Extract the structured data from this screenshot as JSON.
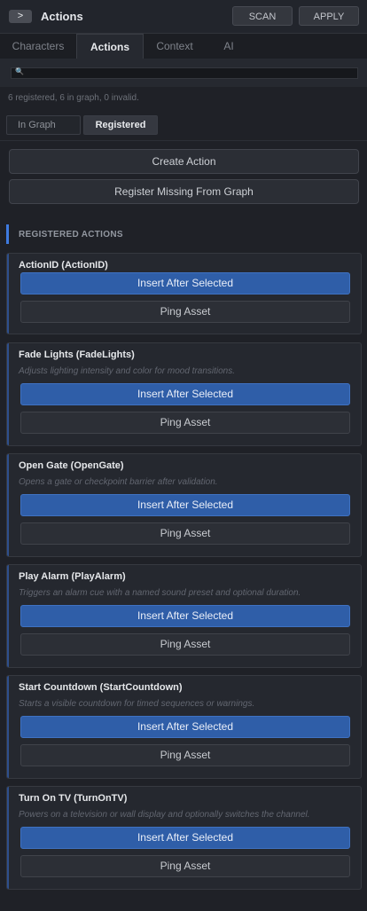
{
  "header": {
    "toggle_icon": "chevron-right-icon",
    "toggle_glyph": ">",
    "title": "Actions",
    "scan_label": "SCAN",
    "apply_label": "APPLY"
  },
  "tabs": [
    {
      "label": "Characters",
      "active": false
    },
    {
      "label": "Actions",
      "active": true
    },
    {
      "label": "Context",
      "active": false
    },
    {
      "label": "AI",
      "active": false
    }
  ],
  "search": {
    "value": "",
    "placeholder": "",
    "icon": "search-icon",
    "glyph": "🔍"
  },
  "status": "6 registered, 6 in graph, 0 invalid.",
  "filter": {
    "in_graph": "In Graph",
    "registered": "Registered",
    "selected": "Registered"
  },
  "buttons": {
    "create": "Create Action",
    "register_missing": "Register Missing From Graph"
  },
  "section_title": "REGISTERED ACTIONS",
  "cards": [
    {
      "title": "ActionID (ActionID)",
      "description": "",
      "insert": "Insert After Selected",
      "ping": "Ping Asset"
    },
    {
      "title": "Fade Lights (FadeLights)",
      "description": "Adjusts lighting intensity and color for mood transitions.",
      "insert": "Insert After Selected",
      "ping": "Ping Asset"
    },
    {
      "title": "Open Gate (OpenGate)",
      "description": "Opens a gate or checkpoint barrier after validation.",
      "insert": "Insert After Selected",
      "ping": "Ping Asset"
    },
    {
      "title": "Play Alarm (PlayAlarm)",
      "description": "Triggers an alarm cue with a named sound preset and optional duration.",
      "insert": "Insert After Selected",
      "ping": "Ping Asset"
    },
    {
      "title": "Start Countdown (StartCountdown)",
      "description": "Starts a visible countdown for timed sequences or warnings.",
      "insert": "Insert After Selected",
      "ping": "Ping Asset"
    },
    {
      "title": "Turn On TV (TurnOnTV)",
      "description": "Powers on a television or wall display and optionally switches the channel.",
      "insert": "Insert After Selected",
      "ping": "Ping Asset"
    }
  ],
  "colors": {
    "accent": "#3e7be0",
    "primary_button": "#2f5ea8",
    "background": "#1f2127"
  }
}
